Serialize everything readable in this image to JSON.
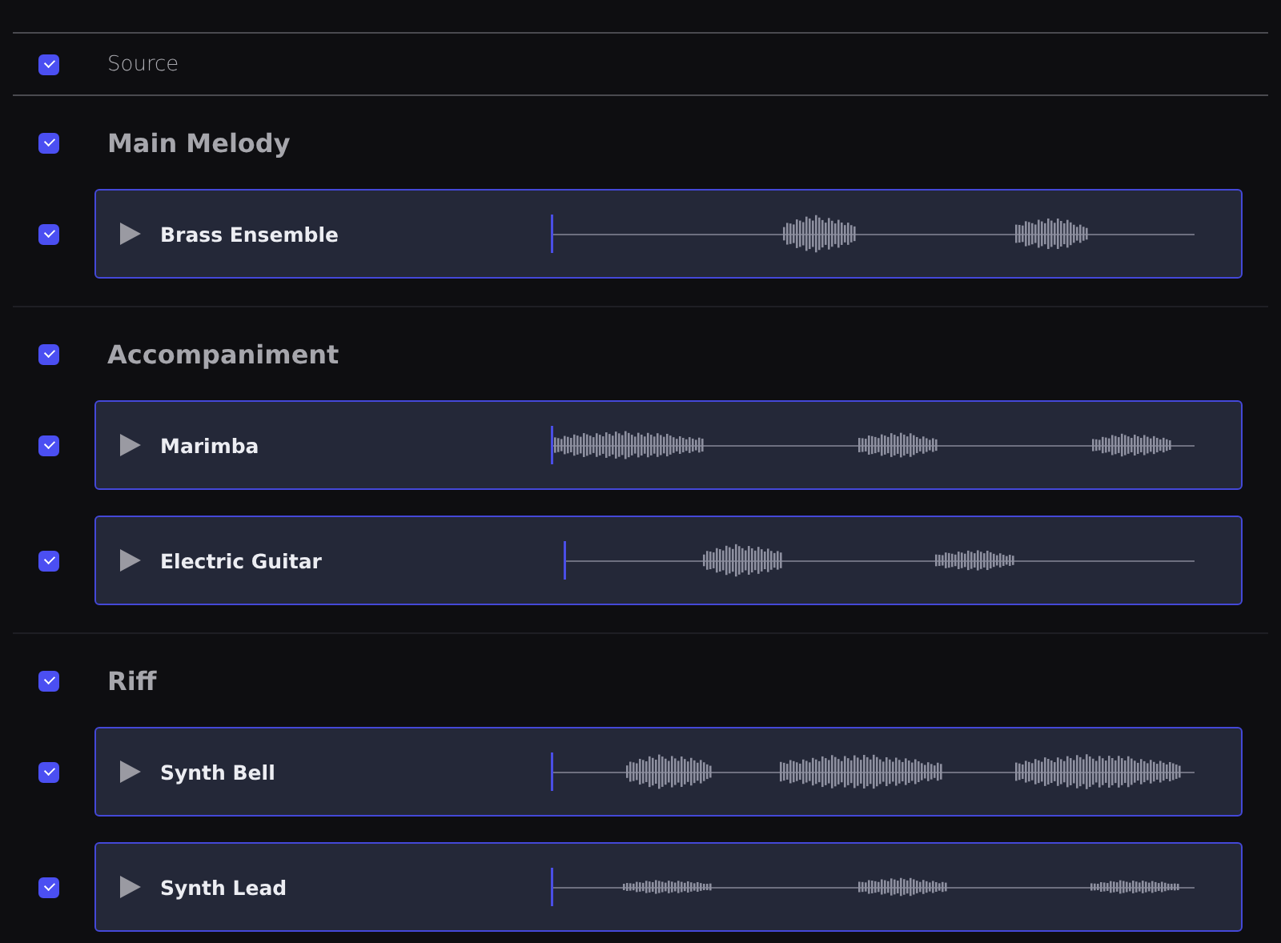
{
  "header": {
    "label": "Source",
    "checked": true
  },
  "groups": [
    {
      "title": "Main Melody",
      "checked": true,
      "tracks": [
        {
          "name": "Brass Ensemble",
          "checked": true
        }
      ]
    },
    {
      "title": "Accompaniment",
      "checked": true,
      "tracks": [
        {
          "name": "Marimba",
          "checked": true
        },
        {
          "name": "Electric Guitar",
          "checked": true
        }
      ]
    },
    {
      "title": "Riff",
      "checked": true,
      "tracks": [
        {
          "name": "Synth Bell",
          "checked": true
        },
        {
          "name": "Synth Lead",
          "checked": true
        }
      ]
    }
  ]
}
